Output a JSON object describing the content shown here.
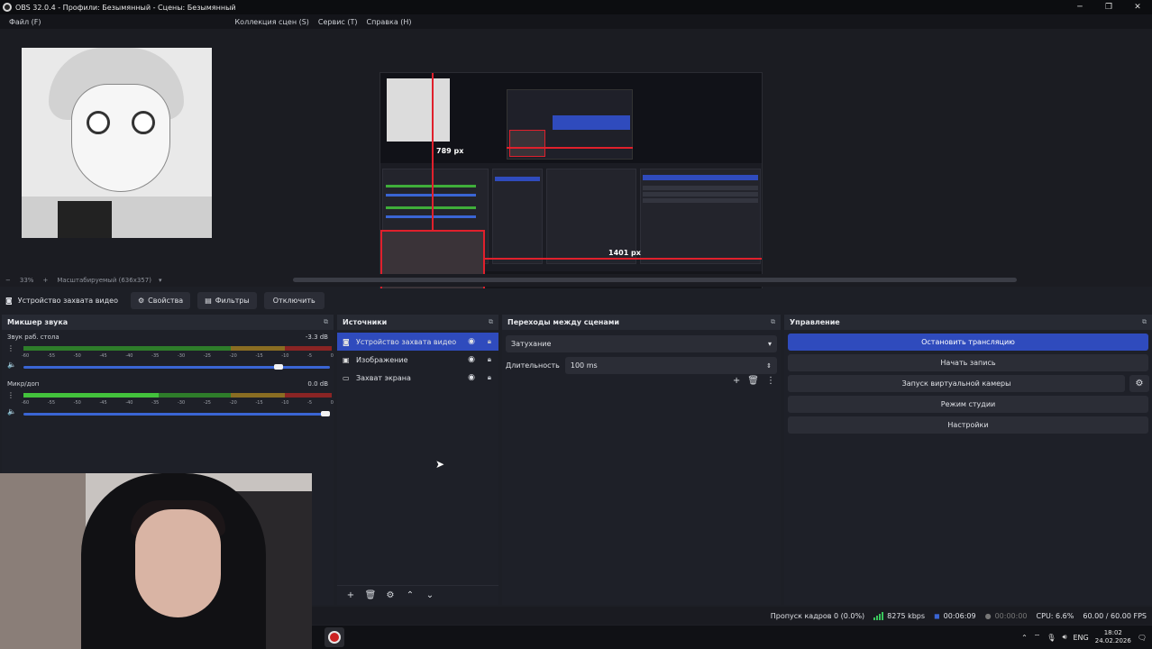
{
  "window": {
    "title": "OBS 32.0.4 - Профили: Безымянный - Сцены: Безымянный",
    "min": "─",
    "max": "❐",
    "close": "✕"
  },
  "menu": {
    "items": [
      "Файл (F)",
      "Коллекция сцен (S)",
      "Сервис (T)",
      "Справка (H)"
    ]
  },
  "preview": {
    "zoom": "33%",
    "scale_mode": "Масштабируемый (636x357)",
    "measure_vertical": "789 px",
    "measure_horizontal": "1401 px"
  },
  "source_toolbar": {
    "source_name": "Устройство захвата видео",
    "properties": "Свойства",
    "filters": "Фильтры",
    "deactivate": "Отключить"
  },
  "mixer": {
    "title": "Микшер звука",
    "channels": [
      {
        "name": "Звук раб. стола",
        "db": "-3.3 dB",
        "volume": 0.84
      },
      {
        "name": "Микр/доп",
        "db": "0.0 dB",
        "volume": 1.0
      }
    ],
    "scale": [
      "-60",
      "-55",
      "-50",
      "-45",
      "-40",
      "-35",
      "-30",
      "-25",
      "-20",
      "-15",
      "-10",
      "-5",
      "0"
    ]
  },
  "sources": {
    "title": "Источники",
    "items": [
      {
        "label": "Устройство захвата видео",
        "icon": "camera-icon",
        "selected": true
      },
      {
        "label": "Изображение",
        "icon": "image-icon",
        "selected": false
      },
      {
        "label": "Захват экрана",
        "icon": "monitor-icon",
        "selected": false
      }
    ]
  },
  "transitions": {
    "title": "Переходы между сценами",
    "selected": "Затухание",
    "duration_label": "Длительность",
    "duration_value": "100 ms"
  },
  "controls": {
    "title": "Управление",
    "stop_stream": "Остановить трансляцию",
    "start_record": "Начать запись",
    "virtual_cam": "Запуск виртуальной камеры",
    "studio_mode": "Режим студии",
    "settings": "Настройки"
  },
  "status": {
    "dropped": "Пропуск кадров 0 (0.0%)",
    "bitrate": "8275 kbps",
    "stream_time": "00:06:09",
    "rec_time": "00:00:00",
    "cpu": "CPU: 6.6%",
    "fps": "60.00 / 60.00 FPS"
  },
  "taskbar": {
    "lang": "ENG",
    "time": "18:02",
    "date": "24.02.2026"
  },
  "colors": {
    "accent": "#2f4bbd",
    "red_guide": "#e0202c",
    "meter_green": "#3fae3a",
    "meter_yellow": "#c8a030",
    "meter_red": "#c83030"
  }
}
